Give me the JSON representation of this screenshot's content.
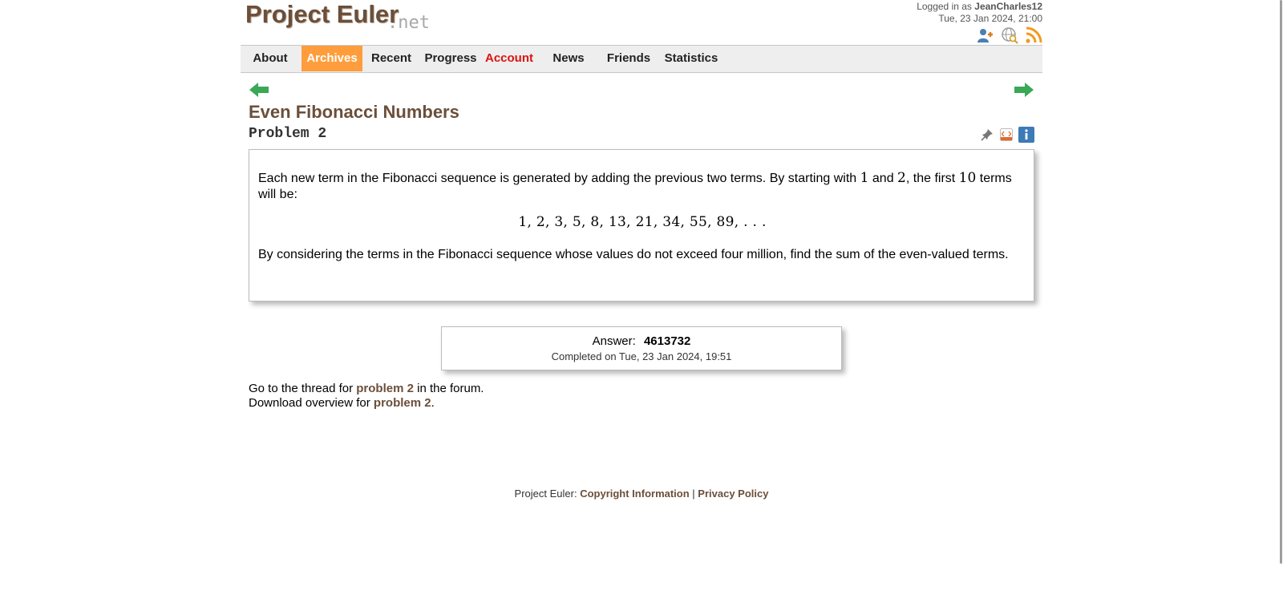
{
  "header": {
    "logo_main": "Project Euler",
    "logo_suffix": ".net",
    "logged_in_prefix": "Logged in as",
    "username": "JeanCharles12",
    "datetime": "Tue, 23 Jan 2024, 21:00",
    "icons": [
      "add-friend-icon",
      "globe-search-icon",
      "rss-icon"
    ]
  },
  "nav": {
    "items": [
      {
        "label": "About"
      },
      {
        "label": "Archives"
      },
      {
        "label": "Recent"
      },
      {
        "label": "Progress"
      },
      {
        "label": "Account"
      },
      {
        "label": "News"
      },
      {
        "label": "Friends"
      },
      {
        "label": "Statistics"
      }
    ],
    "active_color": "#ff9d3c",
    "account_color": "#dd1111"
  },
  "problem": {
    "title": "Even Fibonacci Numbers",
    "number": "Problem 2",
    "icons": [
      "pin-icon",
      "html-source-icon",
      "info-icon"
    ],
    "p1_a": "Each new term in the Fibonacci sequence is generated by adding the previous two terms. By starting with ",
    "p1_m1": "1",
    "p1_b": " and ",
    "p1_m2": "2",
    "p1_c": ", the first ",
    "p1_m3": "10",
    "p1_d": " terms will be:",
    "sequence": "1, 2, 3, 5, 8, 13, 21, 34, 55, 89, . . .",
    "p2": "By considering the terms in the Fibonacci sequence whose values do not exceed four million, find the sum of the even-valued terms."
  },
  "answer": {
    "label": "Answer:",
    "value": "4613732",
    "completed": "Completed on Tue, 23 Jan 2024, 19:51"
  },
  "links": {
    "forum_prefix": "Go to the thread for ",
    "forum_link": "problem 2",
    "forum_suffix": " in the forum.",
    "download_prefix": "Download overview for ",
    "download_link": "problem 2",
    "download_suffix": "."
  },
  "footer": {
    "prefix": "Project Euler: ",
    "copyright": "Copyright Information",
    "separator": " | ",
    "privacy": "Privacy Policy"
  },
  "colors": {
    "brand_brown": "#6b4f3a",
    "arrow_green": "#3aa856"
  }
}
